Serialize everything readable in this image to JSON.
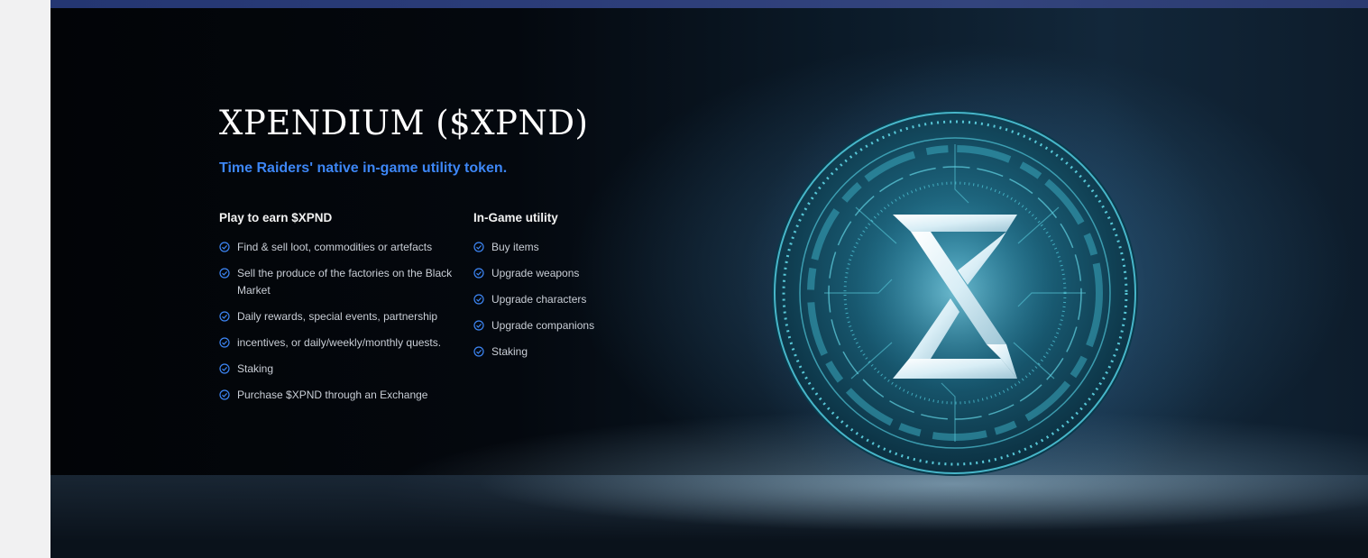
{
  "token": {
    "title": "XPENDIUM ($XPND)",
    "subtitle": "Time Raiders' native in-game utility token."
  },
  "earn": {
    "heading": "Play to earn $XPND",
    "items": [
      "Find & sell loot, commodities or artefacts",
      "Sell the produce of the factories on the Black Market",
      "Daily rewards, special events, partnership",
      "incentives, or daily/weekly/monthly quests.",
      "Staking",
      "Purchase $XPND through an Exchange"
    ]
  },
  "utility": {
    "heading": "In-Game utility",
    "items": [
      "Buy items",
      "Upgrade weapons",
      "Upgrade characters",
      "Upgrade companions",
      "Staking"
    ]
  },
  "icons": {
    "bullet": "check-circle-icon",
    "coin_emblem": "hourglass-x-icon"
  },
  "colors": {
    "accent": "#3d86f5",
    "title": "#ffffff",
    "body_text": "#c9ced6",
    "page_background": "#f1f1f2",
    "hero_background": "#04080e"
  }
}
